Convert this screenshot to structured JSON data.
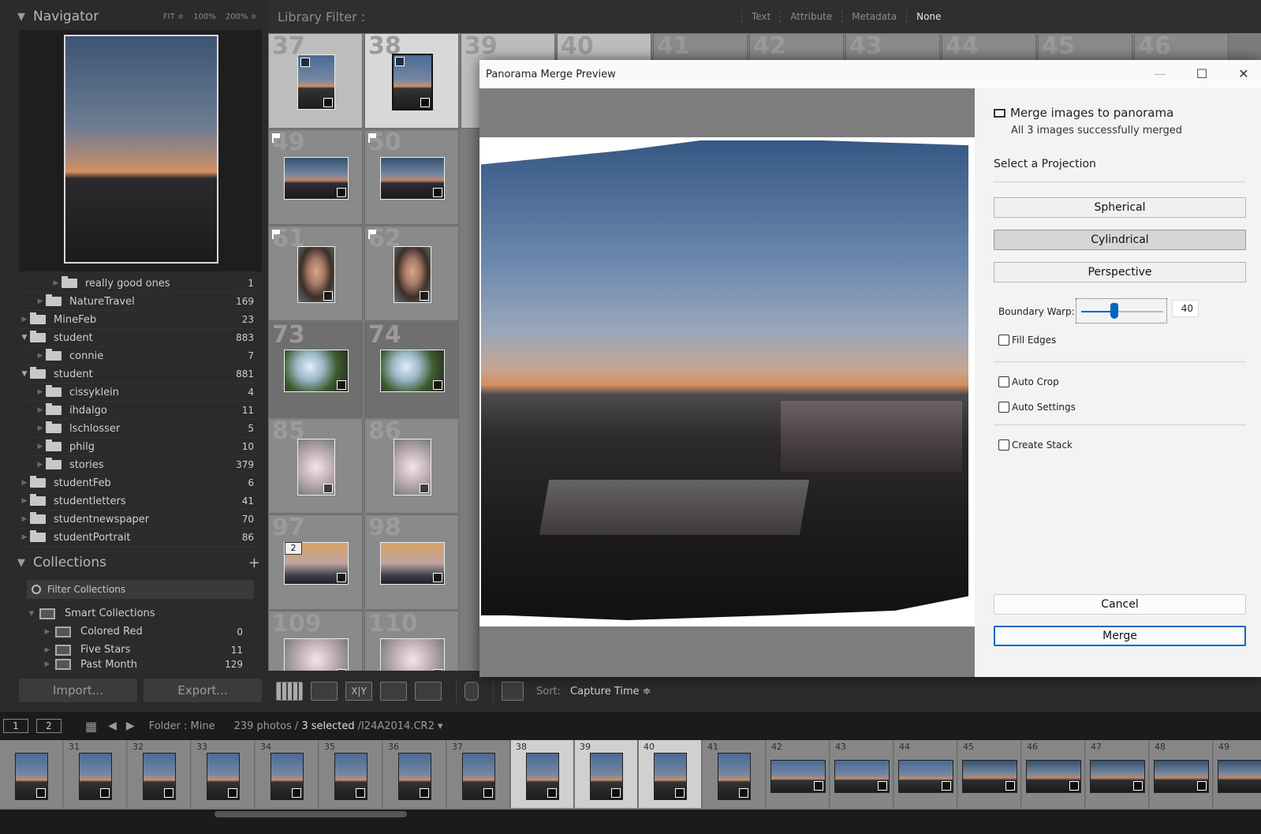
{
  "navigator": {
    "title": "Navigator",
    "zoom_options": [
      "FIT ≑",
      "100%",
      "200% ≑"
    ]
  },
  "folders": [
    {
      "name": "really good ones",
      "count": "1",
      "indent": 2
    },
    {
      "name": "NatureTravel",
      "count": "169",
      "indent": 1
    },
    {
      "name": "MineFeb",
      "count": "23",
      "indent": 0
    },
    {
      "name": "student",
      "count": "883",
      "indent": 0,
      "expanded": true
    },
    {
      "name": "connie",
      "count": "7",
      "indent": 1
    },
    {
      "name": "student",
      "count": "881",
      "indent": 0,
      "expanded": true
    },
    {
      "name": "cissyklein",
      "count": "4",
      "indent": 1
    },
    {
      "name": "ihdalgo",
      "count": "11",
      "indent": 1
    },
    {
      "name": "lschlosser",
      "count": "5",
      "indent": 1
    },
    {
      "name": "philg",
      "count": "10",
      "indent": 1
    },
    {
      "name": "stories",
      "count": "379",
      "indent": 1
    },
    {
      "name": "studentFeb",
      "count": "6",
      "indent": 0
    },
    {
      "name": "studentletters",
      "count": "41",
      "indent": 0
    },
    {
      "name": "studentnewspaper",
      "count": "70",
      "indent": 0
    },
    {
      "name": "studentPortrait",
      "count": "86",
      "indent": 0
    }
  ],
  "collections": {
    "title": "Collections",
    "add_glyph": "+",
    "filter_placeholder": "Filter Collections",
    "items": [
      {
        "name": "Smart Collections",
        "count": "",
        "indent": 0
      },
      {
        "name": "Colored Red",
        "count": "0",
        "indent": 1
      },
      {
        "name": "Five Stars",
        "count": "11",
        "indent": 1
      },
      {
        "name": "Past Month",
        "count": "129",
        "indent": 1
      }
    ]
  },
  "buttons": {
    "import": "Import...",
    "export": "Export..."
  },
  "library_filter": {
    "title": "Library Filter :",
    "tabs": [
      "Text",
      "Attribute",
      "Metadata",
      "None"
    ]
  },
  "grid": {
    "top_numbers": [
      "37",
      "38",
      "39",
      "40",
      "41",
      "42",
      "43",
      "44",
      "45",
      "46"
    ],
    "cells": [
      {
        "num": "37"
      },
      {
        "num": "38"
      },
      {
        "num": "49"
      },
      {
        "num": "50"
      },
      {
        "num": "61"
      },
      {
        "num": "62"
      },
      {
        "num": "73"
      },
      {
        "num": "74"
      },
      {
        "num": "85"
      },
      {
        "num": "86"
      },
      {
        "num": "97"
      },
      {
        "num": "98"
      },
      {
        "num": "109"
      },
      {
        "num": "110"
      }
    ],
    "stack_badge": "2"
  },
  "toolbar": {
    "sort_label": "Sort:",
    "sort_value": "Capture Time ≑",
    "view_labels": [
      "X|Y"
    ]
  },
  "filmstrip": {
    "page_buttons": [
      "1",
      "2"
    ],
    "folder": "Folder : Mine",
    "photo_count": "239 photos /",
    "selected": "3 selected",
    "filename": "/I24A2014.CR2 ▾",
    "numbers": [
      "",
      "31",
      "32",
      "33",
      "34",
      "35",
      "36",
      "37",
      "38",
      "39",
      "40",
      "41",
      "42",
      "43",
      "44",
      "45",
      "46",
      "47",
      "48",
      "49"
    ]
  },
  "dialog": {
    "title": "Panorama Merge Preview",
    "heading": "Merge images to panorama",
    "status": "All 3 images successfully merged",
    "projection_label": "Select a Projection",
    "projections": [
      "Spherical",
      "Cylindrical",
      "Perspective"
    ],
    "active_projection": "Cylindrical",
    "boundary_warp_label": "Boundary Warp:",
    "boundary_warp_value": "40",
    "boundary_warp_fraction": 0.4,
    "checkboxes": {
      "fill_edges": "Fill Edges",
      "auto_crop": "Auto Crop",
      "auto_settings": "Auto Settings",
      "create_stack": "Create Stack"
    },
    "cancel": "Cancel",
    "merge": "Merge",
    "accent_color": "#0067c0"
  }
}
